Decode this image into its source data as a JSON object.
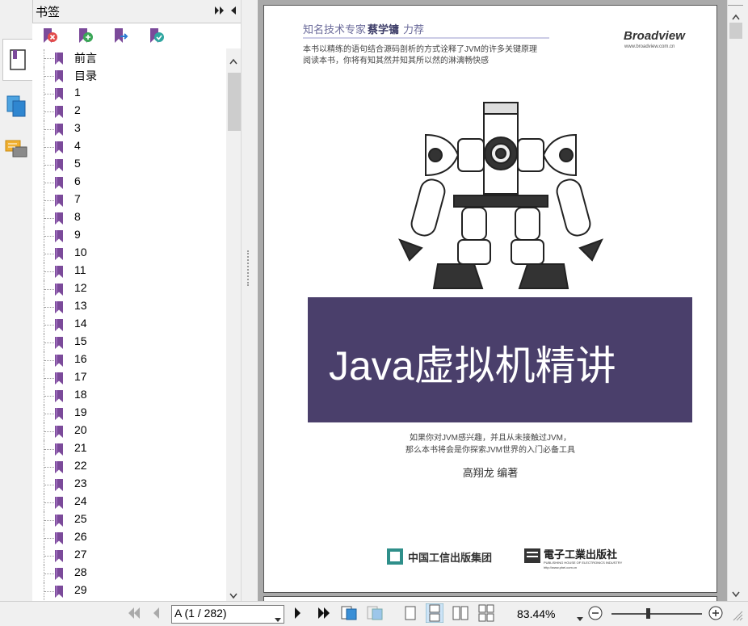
{
  "bookmarks_panel": {
    "title": "书签",
    "items": [
      "前言",
      "目录",
      "1",
      "2",
      "3",
      "4",
      "5",
      "6",
      "7",
      "8",
      "9",
      "10",
      "11",
      "12",
      "13",
      "14",
      "15",
      "16",
      "17",
      "18",
      "19",
      "20",
      "21",
      "22",
      "23",
      "24",
      "25",
      "26",
      "27",
      "28",
      "29"
    ]
  },
  "page": {
    "tagline_prefix": "知名技术专家",
    "tagline_name": "蔡学镛",
    "tagline_suffix": "力荐",
    "publisher_logo": "Broadview",
    "publisher_url": "www.broadview.com.cn",
    "blurb_line1": "本书以精练的语句结合源码剖析的方式诠释了JVM的许多关键原理",
    "blurb_line2": "阅读本书，你将有知其然并知其所以然的淋漓畅快感",
    "book_title": "Java虚拟机精讲",
    "promo_line1": "如果你对JVM感兴趣，并且从未接触过JVM，",
    "promo_line2": "那么本书将会是你探索JVM世界的入门必备工具",
    "author": "高翔龙  编著",
    "publisher1": "中国工信出版集团",
    "publisher2": "電子工業出版社",
    "publisher2_en": "PUBLISHING HOUSE OF ELECTRONICS INDUSTRY",
    "publisher2_url": "http://www.phei.com.cn"
  },
  "toolbar": {
    "page_indicator": "A (1 / 282)",
    "zoom": "83.44%"
  },
  "colors": {
    "title_banner": "#4a3f6b",
    "bookmark_icon": "#7b4a9a"
  }
}
